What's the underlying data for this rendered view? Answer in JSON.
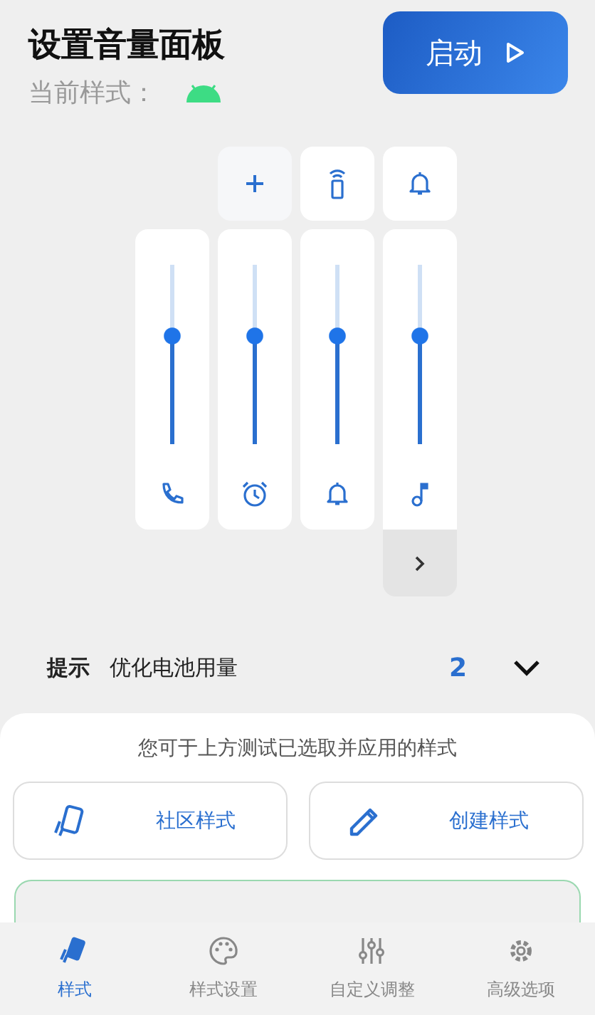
{
  "header": {
    "title": "设置音量面板",
    "subtitle": "当前样式：",
    "start_button": "启动"
  },
  "quick_buttons": [
    {
      "kind": "add"
    },
    {
      "kind": "remote"
    },
    {
      "kind": "bell"
    }
  ],
  "sliders": [
    {
      "kind": "call",
      "level": 0.6
    },
    {
      "kind": "alarm",
      "level": 0.6
    },
    {
      "kind": "ring",
      "level": 0.6
    },
    {
      "kind": "music",
      "level": 0.6
    }
  ],
  "tip": {
    "label": "提示",
    "text": "优化电池用量",
    "count": "2"
  },
  "sheet": {
    "hint": "您可于上方测试已选取并应用的样式",
    "buttons": [
      {
        "kind": "community",
        "label": "社区样式"
      },
      {
        "kind": "create",
        "label": "创建样式"
      }
    ]
  },
  "tabs": [
    {
      "kind": "styles",
      "label": "样式",
      "selected": true
    },
    {
      "kind": "palette",
      "label": "样式设置",
      "selected": false
    },
    {
      "kind": "tune",
      "label": "自定义调整",
      "selected": false
    },
    {
      "kind": "gear",
      "label": "高级选项",
      "selected": false
    }
  ]
}
